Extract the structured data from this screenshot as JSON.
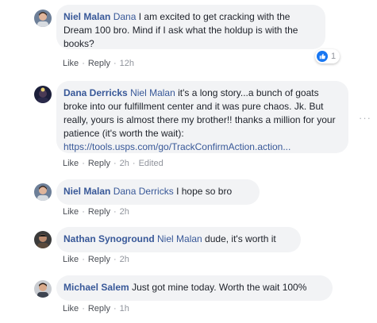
{
  "comments": [
    {
      "author": "Niel Malan",
      "mention": "Dana",
      "text": " I am excited to get cracking with the Dream 100 bro. Mind if I ask what the holdup is with the books?",
      "actions": {
        "like": "Like",
        "reply": "Reply",
        "time": "12h"
      },
      "reaction_count": "1"
    },
    {
      "author": "Dana Derricks",
      "mention": "Niel Malan",
      "text": " it's a long story...a bunch of goats broke into our fulfillment center and it was pure chaos. Jk. But really, yours is almost there my brother!! thanks a million for your patience (it's worth the wait):",
      "link": "https://tools.usps.com/go/TrackConfirmAction.action...",
      "actions": {
        "like": "Like",
        "reply": "Reply",
        "time": "2h",
        "edited": "Edited"
      }
    },
    {
      "author": "Niel Malan",
      "mention": "Dana Derricks",
      "text": " I hope so bro",
      "actions": {
        "like": "Like",
        "reply": "Reply",
        "time": "2h"
      }
    },
    {
      "author": "Nathan Synoground",
      "mention": "Niel Malan",
      "text": " dude, it's worth it",
      "actions": {
        "like": "Like",
        "reply": "Reply",
        "time": "2h"
      }
    },
    {
      "author": "Michael Salem",
      "text": "Just got mine today. Worth the wait 100%",
      "actions": {
        "like": "Like",
        "reply": "Reply",
        "time": "1h"
      }
    }
  ],
  "colors": {
    "bubble": "#f2f3f5",
    "link": "#385898",
    "meta": "#90949c",
    "like_badge": "#1877f2"
  },
  "icons": {
    "reaction": "like-icon",
    "more": "more-options-icon"
  }
}
